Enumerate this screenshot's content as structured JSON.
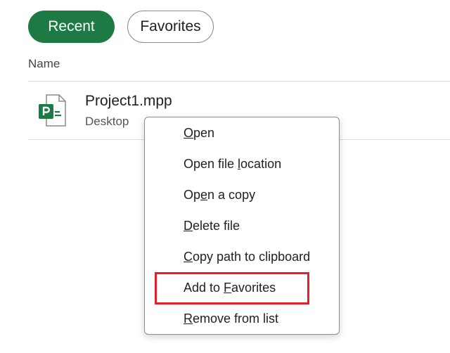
{
  "tabs": [
    {
      "label": "Recent",
      "selected": true
    },
    {
      "label": "Favorites",
      "selected": false
    }
  ],
  "list": {
    "column_header": "Name",
    "files": [
      {
        "name": "Project1.mpp",
        "location": "Desktop",
        "icon": "project-file-icon"
      }
    ]
  },
  "context_menu": {
    "items": [
      {
        "label": "Open",
        "pre": "",
        "key": "O",
        "post": "pen"
      },
      {
        "label": "Open file location",
        "pre": "Open file ",
        "key": "l",
        "post": "ocation"
      },
      {
        "label": "Open a copy",
        "pre": "Op",
        "key": "e",
        "post": "n a copy"
      },
      {
        "label": "Delete file",
        "pre": "",
        "key": "D",
        "post": "elete file"
      },
      {
        "label": "Copy path to clipboard",
        "pre": "",
        "key": "C",
        "post": "opy path to clipboard"
      },
      {
        "label": "Add to Favorites",
        "pre": "Add to ",
        "key": "F",
        "post": "avorites"
      },
      {
        "label": "Remove from list",
        "pre": "",
        "key": "R",
        "post": "emove from list"
      }
    ],
    "highlighted_item": "Add to Favorites"
  },
  "colors": {
    "accent_green": "#1e7a45",
    "highlight_red": "#e2202c"
  }
}
